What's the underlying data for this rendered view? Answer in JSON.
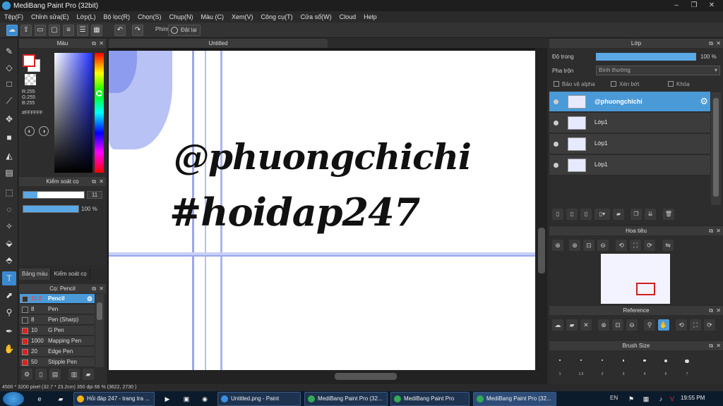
{
  "window": {
    "title": "MediBang Paint Pro (32bit)"
  },
  "menu": [
    "Tệp(F)",
    "Chỉnh sửa(E)",
    "Lớp(L)",
    "Bộ lọc(R)",
    "Chọn(S)",
    "Chụp(N)",
    "Màu (C)",
    "Xem(V)",
    "Công cụ(T)",
    "Cửa sổ(W)",
    "Cloud",
    "Help"
  ],
  "toolbar": {
    "phim_label": "Phím",
    "reset_label": "Đặt lại"
  },
  "color_panel": {
    "title": "Màu",
    "rgb": "R:255\nG:255\nB:255",
    "hex": "#FFFFFF",
    "fg_color": "#FFFFFF",
    "bg_color": "#FFFFFF"
  },
  "brush_control": {
    "title": "Kiểm soát cọ",
    "size": "11",
    "opacity": "100 %",
    "size_level": 0.85,
    "opacity_level": 1.0
  },
  "left_tabs": [
    "Bảng màu",
    "Kiểm soát cọ"
  ],
  "brush_panel": {
    "title": "Cọ: Pencil",
    "items": [
      {
        "size": "11.0",
        "name": "Pencil",
        "color": "#333333",
        "selected": true
      },
      {
        "size": "8",
        "name": "Pen",
        "color": "#333333"
      },
      {
        "size": "8",
        "name": "Pen (Sharp)",
        "color": "#333333"
      },
      {
        "size": "10",
        "name": "G Pen",
        "color": "#e02020"
      },
      {
        "size": "1000",
        "name": "Mapping Pen",
        "color": "#e02020"
      },
      {
        "size": "20",
        "name": "Edge Pen",
        "color": "#e02020"
      },
      {
        "size": "50",
        "name": "Stipple Pen",
        "color": "#e02020"
      }
    ]
  },
  "document": {
    "tab_title": "Untitled",
    "text_line1": "@phuongchichi",
    "text_line2": "#hoidap247"
  },
  "layer_panel": {
    "title": "Lớp",
    "opacity_label": "Độ trong",
    "opacity_value": "100 %",
    "blend_label": "Pha trộn",
    "blend_value": "Bình thường",
    "protect_alpha": "Bảo vệ alpha",
    "clipping": "Xén bớt",
    "lock": "Khóa",
    "layers": [
      {
        "name": "@phuongchichi",
        "selected": true
      },
      {
        "name": "Lớp1"
      },
      {
        "name": "Lớp1"
      },
      {
        "name": "Lớp1"
      }
    ]
  },
  "navigator": {
    "title": "Hoa tiêu"
  },
  "reference": {
    "title": "Reference"
  },
  "brush_size_panel": {
    "title": "Brush Size",
    "sizes": [
      "1",
      "1.5",
      "2",
      "3",
      "4",
      "5",
      "7"
    ]
  },
  "statusbar": {
    "text": "4500 * 3200 pixel  (32.7 * 23.2cm)  350 dpi  66 %  (3622, 2730 )"
  },
  "taskbar": {
    "tasks": [
      {
        "label": "Hỏi đáp 247 - trang tra ...",
        "color": "#f2b417"
      },
      {
        "label": "Untitled.png - Paint",
        "color": "#3b8fe0"
      },
      {
        "label": "MediBang Paint Pro (32...",
        "color": "#33aa55"
      },
      {
        "label": "MediBang Paint Pro",
        "color": "#33aa55"
      },
      {
        "label": "MediBang Paint Pro (32...",
        "color": "#33aa55",
        "active": true
      }
    ],
    "lang": "EN",
    "clock": "19:55 PM"
  }
}
